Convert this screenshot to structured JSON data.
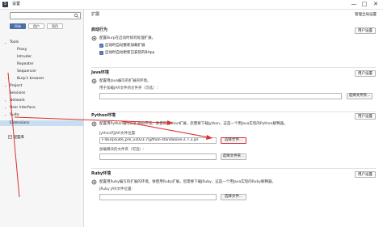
{
  "window": {
    "app_icon_text": "S",
    "title": "设置",
    "controls": [
      "—",
      "□",
      "✕"
    ]
  },
  "sidebar": {
    "search_placeholder": "",
    "filters": [
      "所有",
      "用户",
      "项目"
    ],
    "tree": [
      {
        "arrow": "⌄",
        "label": "Tools",
        "indent": 0
      },
      {
        "arrow": "",
        "label": "Proxy",
        "indent": 1
      },
      {
        "arrow": "",
        "label": "Intruder",
        "indent": 1
      },
      {
        "arrow": "",
        "label": "Repeater",
        "indent": 1
      },
      {
        "arrow": "",
        "label": "Sequencer",
        "indent": 1
      },
      {
        "arrow": "",
        "label": "Burp's browser",
        "indent": 1
      },
      {
        "arrow": "›",
        "label": "Project",
        "indent": 0
      },
      {
        "arrow": "",
        "label": "Sessions",
        "indent": 0
      },
      {
        "arrow": "›",
        "label": "Network",
        "indent": 0
      },
      {
        "arrow": "›",
        "label": "User interface",
        "indent": 0
      },
      {
        "arrow": "›",
        "label": "Suite",
        "indent": 0
      },
      {
        "arrow": "",
        "label": "Extensions",
        "indent": 0,
        "selected": true
      }
    ],
    "footer_label": "配置库"
  },
  "main": {
    "header_title": "扩展",
    "header_link": "管理全局设置",
    "startup": {
      "title": "启动行为",
      "button": "用户设置",
      "desc": "配置Burp在启动时如何处理扩展。",
      "checks": [
        "启动时自动重新加载扩展",
        "启动时自动更新已安装的BApp"
      ]
    },
    "java": {
      "title": "Java环境",
      "button": "用户设置",
      "desc": "配置用Java编写的扩展的环境。",
      "field_label": "用于加载JAR文件的文件夹（可选）:",
      "field_value": "",
      "file_button": "选择文件夹..."
    },
    "python": {
      "title": "Python环境",
      "button": "用户设置",
      "desc": "配置用Python编写的扩展的环境。要使用Python扩展，您需要下载Jython，这是一个用Java实现的Python解释器。",
      "jar_label": "Jython的JAR文件位置:",
      "jar_value": "F:\\burpsuite_pro_v2023.7\\jython-standalone-2.7.3.jar",
      "jar_button": "选择文件...",
      "module_label": "加载模块的文件夹（可选）:",
      "module_value": "",
      "module_button": "选择文件夹..."
    },
    "ruby": {
      "title": "Ruby环境",
      "button": "用户设置",
      "desc": "配置用Ruby编写的扩展的环境。要使用Ruby扩展，您需要下载JRuby，这是一个用Java实现的Ruby解释器。",
      "field_label": "JRuby JAR文件位置:",
      "field_value": "",
      "file_button": "选择文件..."
    }
  }
}
